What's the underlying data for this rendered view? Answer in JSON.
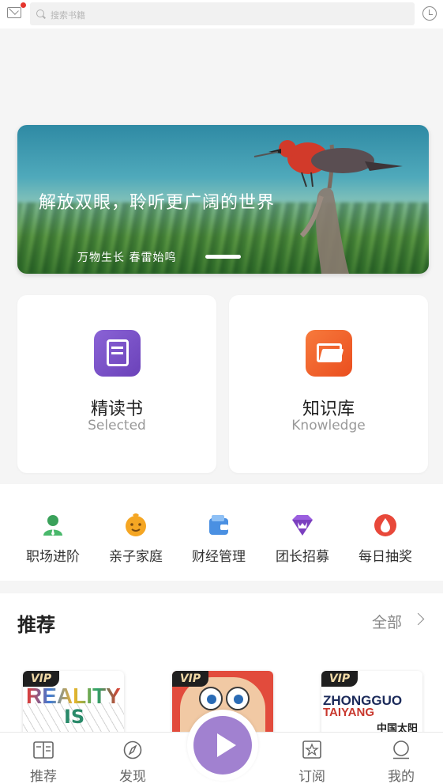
{
  "header": {
    "mail_icon": "mail-icon",
    "notification_dot": true,
    "search_placeholder": "搜索书籍",
    "history_icon": "clock-icon"
  },
  "banner": {
    "title": "解放双眼，聆听更广阔的世界",
    "subtitle": "万物生长  春雷始鸣"
  },
  "feature_cards": [
    {
      "title": "精读书",
      "subtitle": "Selected",
      "icon": "book-icon",
      "color": "#7b55c8"
    },
    {
      "title": "知识库",
      "subtitle": "Knowledge",
      "icon": "folder-icon",
      "color": "#f2612a"
    }
  ],
  "categories": [
    {
      "label": "职场进阶",
      "icon": "career-icon",
      "color": "#3aa15a"
    },
    {
      "label": "亲子家庭",
      "icon": "child-face-icon",
      "color": "#f5a623"
    },
    {
      "label": "财经管理",
      "icon": "wallet-icon",
      "color": "#4a90e2"
    },
    {
      "label": "团长招募",
      "icon": "crown-gem-icon",
      "color": "#7b3fbf"
    },
    {
      "label": "每日抽奖",
      "icon": "drop-lottery-icon",
      "color": "#e8483a"
    }
  ],
  "recommend": {
    "heading": "推荐",
    "more_label": "全部",
    "books": [
      {
        "badge": "VIP",
        "cover_text": "REALITY",
        "cover_sub": "IS"
      },
      {
        "badge": "VIP"
      },
      {
        "badge": "VIP",
        "cover_text": "ZHONGGUO",
        "cover_sub": "TAIYANG",
        "cover_cn": "中国太阳"
      }
    ]
  },
  "bottom_nav": [
    {
      "label": "推荐",
      "icon": "book-open-icon"
    },
    {
      "label": "发现",
      "icon": "compass-icon"
    },
    {
      "label": "订阅",
      "icon": "star-frame-icon"
    },
    {
      "label": "我的",
      "icon": "user-icon"
    }
  ],
  "player_button_icon": "play-icon"
}
